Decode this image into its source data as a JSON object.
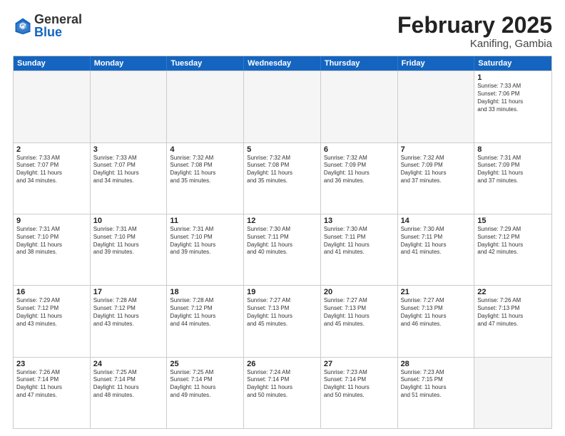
{
  "logo": {
    "general": "General",
    "blue": "Blue"
  },
  "title": {
    "month": "February 2025",
    "location": "Kanifing, Gambia"
  },
  "header_days": [
    "Sunday",
    "Monday",
    "Tuesday",
    "Wednesday",
    "Thursday",
    "Friday",
    "Saturday"
  ],
  "rows": [
    [
      {
        "day": "",
        "text": "",
        "empty": true
      },
      {
        "day": "",
        "text": "",
        "empty": true
      },
      {
        "day": "",
        "text": "",
        "empty": true
      },
      {
        "day": "",
        "text": "",
        "empty": true
      },
      {
        "day": "",
        "text": "",
        "empty": true
      },
      {
        "day": "",
        "text": "",
        "empty": true
      },
      {
        "day": "1",
        "text": "Sunrise: 7:33 AM\nSunset: 7:06 PM\nDaylight: 11 hours\nand 33 minutes.",
        "empty": false
      }
    ],
    [
      {
        "day": "2",
        "text": "Sunrise: 7:33 AM\nSunset: 7:07 PM\nDaylight: 11 hours\nand 34 minutes.",
        "empty": false
      },
      {
        "day": "3",
        "text": "Sunrise: 7:33 AM\nSunset: 7:07 PM\nDaylight: 11 hours\nand 34 minutes.",
        "empty": false
      },
      {
        "day": "4",
        "text": "Sunrise: 7:32 AM\nSunset: 7:08 PM\nDaylight: 11 hours\nand 35 minutes.",
        "empty": false
      },
      {
        "day": "5",
        "text": "Sunrise: 7:32 AM\nSunset: 7:08 PM\nDaylight: 11 hours\nand 35 minutes.",
        "empty": false
      },
      {
        "day": "6",
        "text": "Sunrise: 7:32 AM\nSunset: 7:09 PM\nDaylight: 11 hours\nand 36 minutes.",
        "empty": false
      },
      {
        "day": "7",
        "text": "Sunrise: 7:32 AM\nSunset: 7:09 PM\nDaylight: 11 hours\nand 37 minutes.",
        "empty": false
      },
      {
        "day": "8",
        "text": "Sunrise: 7:31 AM\nSunset: 7:09 PM\nDaylight: 11 hours\nand 37 minutes.",
        "empty": false
      }
    ],
    [
      {
        "day": "9",
        "text": "Sunrise: 7:31 AM\nSunset: 7:10 PM\nDaylight: 11 hours\nand 38 minutes.",
        "empty": false
      },
      {
        "day": "10",
        "text": "Sunrise: 7:31 AM\nSunset: 7:10 PM\nDaylight: 11 hours\nand 39 minutes.",
        "empty": false
      },
      {
        "day": "11",
        "text": "Sunrise: 7:31 AM\nSunset: 7:10 PM\nDaylight: 11 hours\nand 39 minutes.",
        "empty": false
      },
      {
        "day": "12",
        "text": "Sunrise: 7:30 AM\nSunset: 7:11 PM\nDaylight: 11 hours\nand 40 minutes.",
        "empty": false
      },
      {
        "day": "13",
        "text": "Sunrise: 7:30 AM\nSunset: 7:11 PM\nDaylight: 11 hours\nand 41 minutes.",
        "empty": false
      },
      {
        "day": "14",
        "text": "Sunrise: 7:30 AM\nSunset: 7:11 PM\nDaylight: 11 hours\nand 41 minutes.",
        "empty": false
      },
      {
        "day": "15",
        "text": "Sunrise: 7:29 AM\nSunset: 7:12 PM\nDaylight: 11 hours\nand 42 minutes.",
        "empty": false
      }
    ],
    [
      {
        "day": "16",
        "text": "Sunrise: 7:29 AM\nSunset: 7:12 PM\nDaylight: 11 hours\nand 43 minutes.",
        "empty": false
      },
      {
        "day": "17",
        "text": "Sunrise: 7:28 AM\nSunset: 7:12 PM\nDaylight: 11 hours\nand 43 minutes.",
        "empty": false
      },
      {
        "day": "18",
        "text": "Sunrise: 7:28 AM\nSunset: 7:12 PM\nDaylight: 11 hours\nand 44 minutes.",
        "empty": false
      },
      {
        "day": "19",
        "text": "Sunrise: 7:27 AM\nSunset: 7:13 PM\nDaylight: 11 hours\nand 45 minutes.",
        "empty": false
      },
      {
        "day": "20",
        "text": "Sunrise: 7:27 AM\nSunset: 7:13 PM\nDaylight: 11 hours\nand 45 minutes.",
        "empty": false
      },
      {
        "day": "21",
        "text": "Sunrise: 7:27 AM\nSunset: 7:13 PM\nDaylight: 11 hours\nand 46 minutes.",
        "empty": false
      },
      {
        "day": "22",
        "text": "Sunrise: 7:26 AM\nSunset: 7:13 PM\nDaylight: 11 hours\nand 47 minutes.",
        "empty": false
      }
    ],
    [
      {
        "day": "23",
        "text": "Sunrise: 7:26 AM\nSunset: 7:14 PM\nDaylight: 11 hours\nand 47 minutes.",
        "empty": false
      },
      {
        "day": "24",
        "text": "Sunrise: 7:25 AM\nSunset: 7:14 PM\nDaylight: 11 hours\nand 48 minutes.",
        "empty": false
      },
      {
        "day": "25",
        "text": "Sunrise: 7:25 AM\nSunset: 7:14 PM\nDaylight: 11 hours\nand 49 minutes.",
        "empty": false
      },
      {
        "day": "26",
        "text": "Sunrise: 7:24 AM\nSunset: 7:14 PM\nDaylight: 11 hours\nand 50 minutes.",
        "empty": false
      },
      {
        "day": "27",
        "text": "Sunrise: 7:23 AM\nSunset: 7:14 PM\nDaylight: 11 hours\nand 50 minutes.",
        "empty": false
      },
      {
        "day": "28",
        "text": "Sunrise: 7:23 AM\nSunset: 7:15 PM\nDaylight: 11 hours\nand 51 minutes.",
        "empty": false
      },
      {
        "day": "",
        "text": "",
        "empty": true
      }
    ]
  ]
}
